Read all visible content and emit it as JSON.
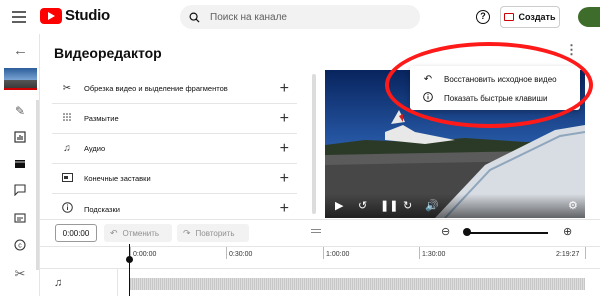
{
  "header": {
    "brand": "Studio",
    "search_placeholder": "Поиск на канале",
    "help_icon": "help-circle-icon",
    "create_label": "Создать"
  },
  "sidebar": {
    "icons": [
      "back-arrow-icon",
      "pencil-icon",
      "analytics-icon",
      "editor-film-icon",
      "comments-icon",
      "subtitles-icon",
      "copyright-icon",
      "scissors-icon"
    ]
  },
  "editor": {
    "title": "Видеоредактор",
    "tools": [
      {
        "label": "Обрезка видео и выделение фрагментов",
        "icon": "scissors-icon"
      },
      {
        "label": "Размытие",
        "icon": "blur-icon"
      },
      {
        "label": "Аудио",
        "icon": "music-note-icon"
      },
      {
        "label": "Конечные заставки",
        "icon": "end-screen-icon"
      },
      {
        "label": "Подсказки",
        "icon": "info-icon"
      }
    ],
    "more_menu": {
      "items": [
        {
          "label": "Восстановить исходное видео",
          "icon": "undo-icon"
        },
        {
          "label": "Показать быстрые клавиши",
          "icon": "info-icon"
        }
      ]
    }
  },
  "timeline": {
    "current_time": "0:00:00",
    "undo_label": "Отменить",
    "redo_label": "Повторить",
    "ruler_labels": [
      "0:00:00",
      "0:30:00",
      "1:00:00",
      "1:30:00",
      "2:19:27"
    ]
  },
  "colors": {
    "brand_red": "#ff0000",
    "highlight_oval": "#ff1a1a"
  }
}
